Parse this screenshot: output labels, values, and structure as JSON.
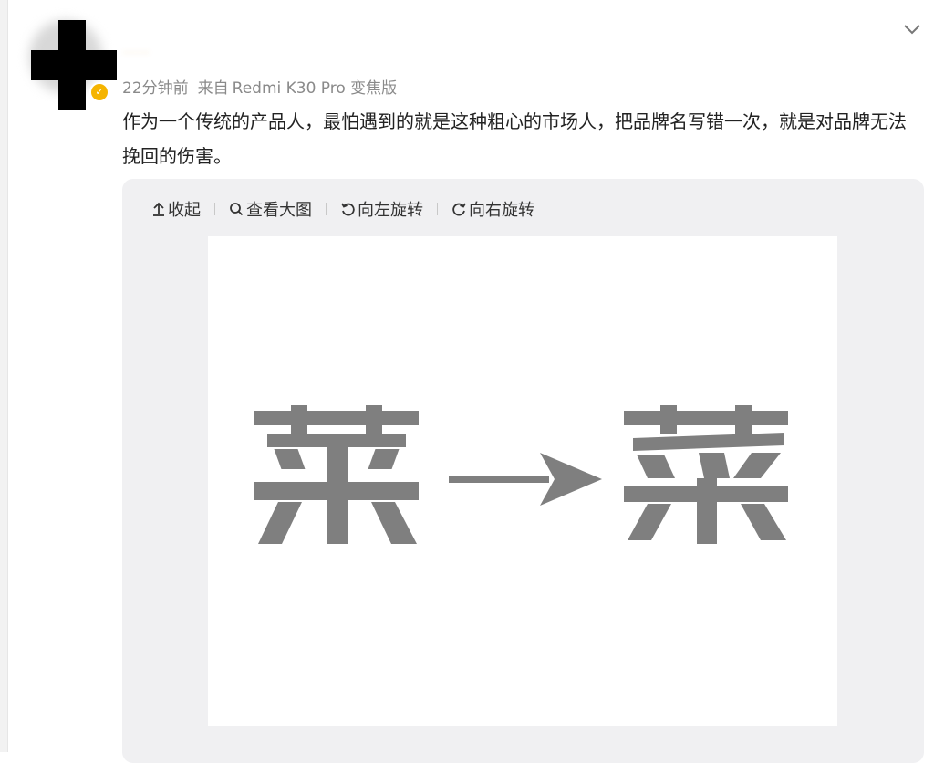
{
  "post": {
    "user_name": "······",
    "time": "22分钟前",
    "source_prefix": "来自",
    "source_device": "Redmi K30 Pro 变焦版",
    "text": "作为一个传统的产品人，最怕遇到的就是这种粗心的市场人，把品牌名写错一次，就是对品牌无法挽回的伤害。"
  },
  "toolbar": {
    "collapse": "收起",
    "view_large": "查看大图",
    "rotate_left": "向左旋转",
    "rotate_right": "向右旋转"
  },
  "image": {
    "left_char": "莱",
    "right_char": "菜"
  },
  "icons": [
    "chevron-down-icon",
    "verified-icon",
    "collapse-icon",
    "zoom-icon",
    "rotate-left-icon",
    "rotate-right-icon",
    "arrow-right-icon"
  ],
  "colors": {
    "verified": "#f5b400",
    "logo_gray": "#7f7f7f",
    "meta_text": "#8a8a8a"
  }
}
